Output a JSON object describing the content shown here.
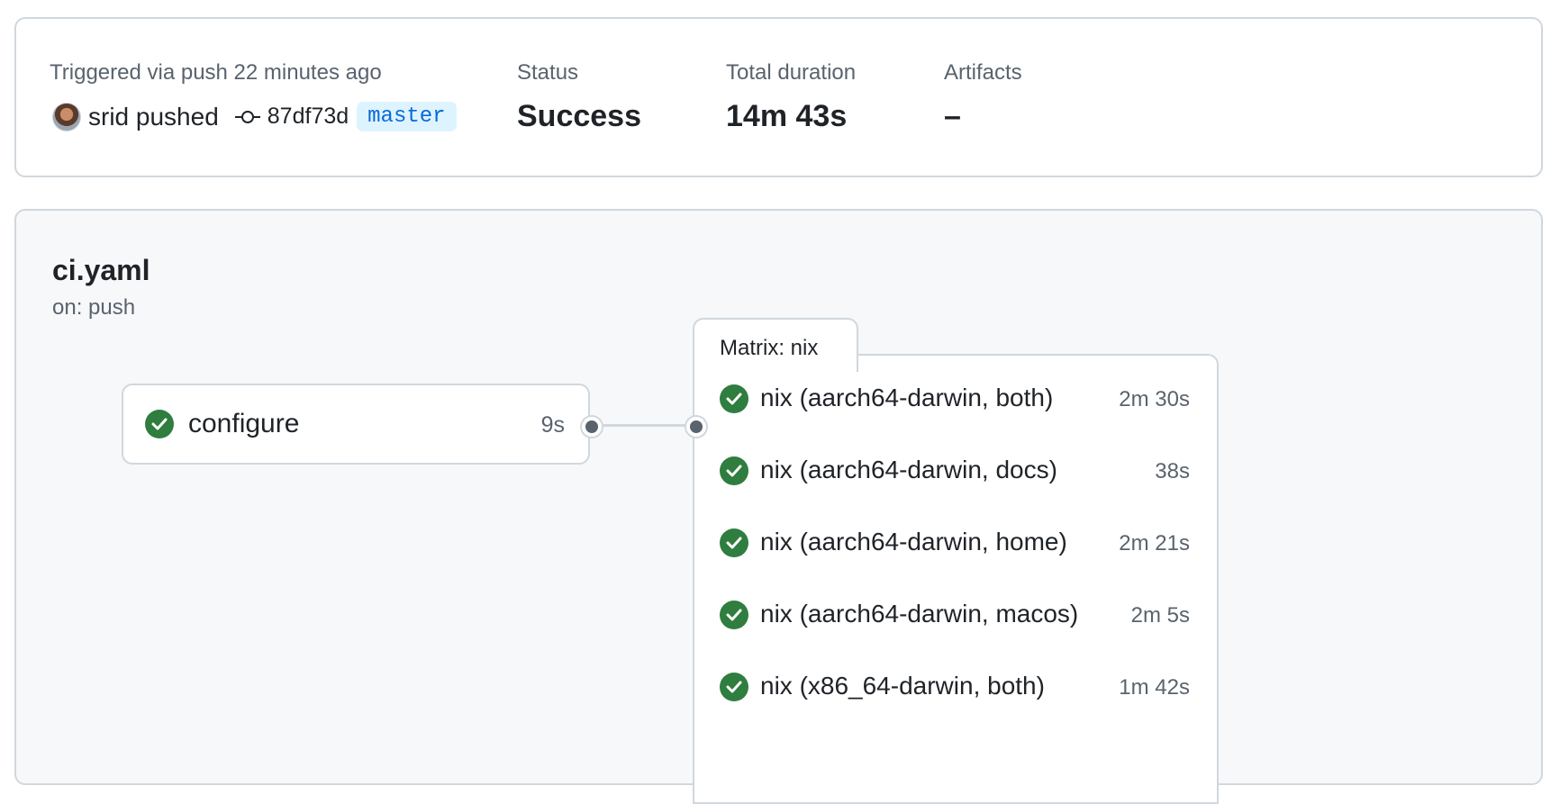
{
  "summary": {
    "trigger_text": "Triggered via push 22 minutes ago",
    "actor": "srid",
    "action": "pushed",
    "commit_sha": "87df73d",
    "branch": "master",
    "status_label": "Status",
    "status_value": "Success",
    "duration_label": "Total duration",
    "duration_value": "14m 43s",
    "artifacts_label": "Artifacts",
    "artifacts_value": "–"
  },
  "workflow": {
    "name": "ci.yaml",
    "trigger": "on: push"
  },
  "jobs": [
    {
      "name": "configure",
      "duration": "9s",
      "status": "success"
    }
  ],
  "matrix": {
    "label": "Matrix: nix",
    "jobs": [
      {
        "name": "nix (aarch64-darwin, both)",
        "duration": "2m 30s",
        "status": "success"
      },
      {
        "name": "nix (aarch64-darwin, docs)",
        "duration": "38s",
        "status": "success"
      },
      {
        "name": "nix (aarch64-darwin, home)",
        "duration": "2m 21s",
        "status": "success"
      },
      {
        "name": "nix (aarch64-darwin, macos)",
        "duration": "2m 5s",
        "status": "success"
      },
      {
        "name": "nix (x86_64-darwin, both)",
        "duration": "1m 42s",
        "status": "success"
      }
    ]
  },
  "colors": {
    "success": "#2f7d3f",
    "branch_text": "#0969da",
    "branch_bg": "#ddf4ff",
    "border": "#d0d7de",
    "canvas_bg": "#f6f8fa"
  }
}
